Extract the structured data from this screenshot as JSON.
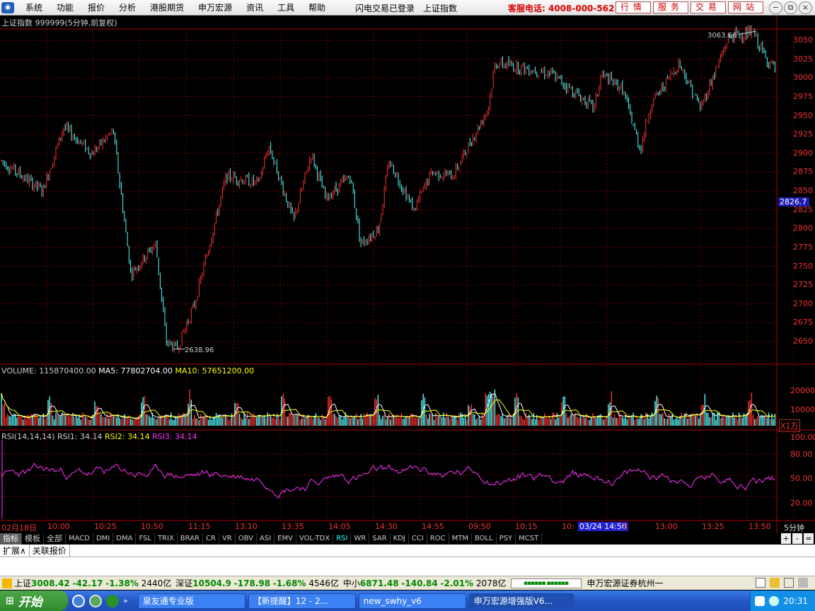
{
  "menubar": {
    "items": [
      "系统",
      "功能",
      "报价",
      "分析",
      "港股期货",
      "申万宏源",
      "资讯",
      "工具",
      "帮助"
    ],
    "status": [
      "闪电交易已登录",
      "上证指数"
    ],
    "hotline": "客服电话: 4008-000-562",
    "quick_buttons": [
      "行情",
      "服务",
      "交易",
      "网站"
    ],
    "window_controls": [
      "−",
      "⧉",
      "×"
    ]
  },
  "main_chart": {
    "title": "上证指数 999999(5分钟,前复权)",
    "y_ticks": [
      "3050",
      "3025",
      "3000",
      "2975",
      "2950",
      "2925",
      "2900",
      "2875",
      "2850",
      "2825",
      "2800",
      "2775",
      "2750",
      "2725",
      "2700",
      "2675",
      "2650"
    ],
    "current_price": "2826.7",
    "high_label": "3063.66",
    "low_label": "2638.96"
  },
  "volume_panel": {
    "title": "VOLUME: 115870400.00",
    "ma5": "MA5: 77802704.00",
    "ma10": "MA10: 57651200.00",
    "y_ticks": [
      "20000",
      "10000"
    ],
    "unit": "X1万"
  },
  "rsi_panel": {
    "title": "RSI(14,14,14)",
    "rsi1": "RSI1: 34.14",
    "rsi2": "RSI2: 34.14",
    "rsi3": "RSI3: 34.14",
    "y_ticks": [
      "100.00",
      "80.00",
      "50.00",
      "20.00"
    ]
  },
  "time_axis": {
    "labels": [
      "02月18日",
      "10:00",
      "10:25",
      "10:50",
      "11:15",
      "13:10",
      "13:35",
      "14:05",
      "14:30",
      "14:55",
      "09:50",
      "10:15",
      "10:",
      "13:00",
      "13:25",
      "13:50"
    ],
    "cursor_label": "03/24 14:50",
    "cursor_suffix": "5",
    "period": "5分钟"
  },
  "indicator_tabs": [
    "指标",
    "模板",
    "全部",
    "MACD",
    "DMI",
    "DMA",
    "FSL",
    "TRIX",
    "BRAR",
    "CR",
    "VR",
    "OBV",
    "ASI",
    "EMV",
    "VOL-TDX",
    "RSI",
    "WR",
    "SAR",
    "KDJ",
    "CCI",
    "ROC",
    "MTM",
    "BOLL",
    "PSY",
    "MCST"
  ],
  "indicator_controls": [
    "+",
    "-",
    "="
  ],
  "ext_tabs": [
    "扩展∧",
    "关联报价"
  ],
  "statusbar": {
    "sh_label": "上证",
    "sh_value": "3008.42",
    "sh_change": "-42.17",
    "sh_pct": "-1.38%",
    "sh_amount": "2440亿",
    "sz_label": "深证",
    "sz_value": "10504.9",
    "sz_change": "-178.98",
    "sz_pct": "-1.68%",
    "sz_amount": "4546亿",
    "zx_label": "中小",
    "zx_value": "6871.48",
    "zx_change": "-140.84",
    "zx_pct": "-2.01%",
    "zx_amount": "2078亿",
    "broker": "申万宏源证券杭州一"
  },
  "taskbar": {
    "start": "开始",
    "tasks": [
      "泉友通专业版",
      "【新提醒】12 - 2...",
      "new_swhy_v6",
      "申万宏源增强版V6..."
    ],
    "clock": "20:31"
  },
  "colors": {
    "up": "#ff3232",
    "down": "#54ffff",
    "grid": "#7a0000",
    "rsi": "#ff32ff",
    "ma5": "#ffffff",
    "ma10": "#ffff00"
  }
}
